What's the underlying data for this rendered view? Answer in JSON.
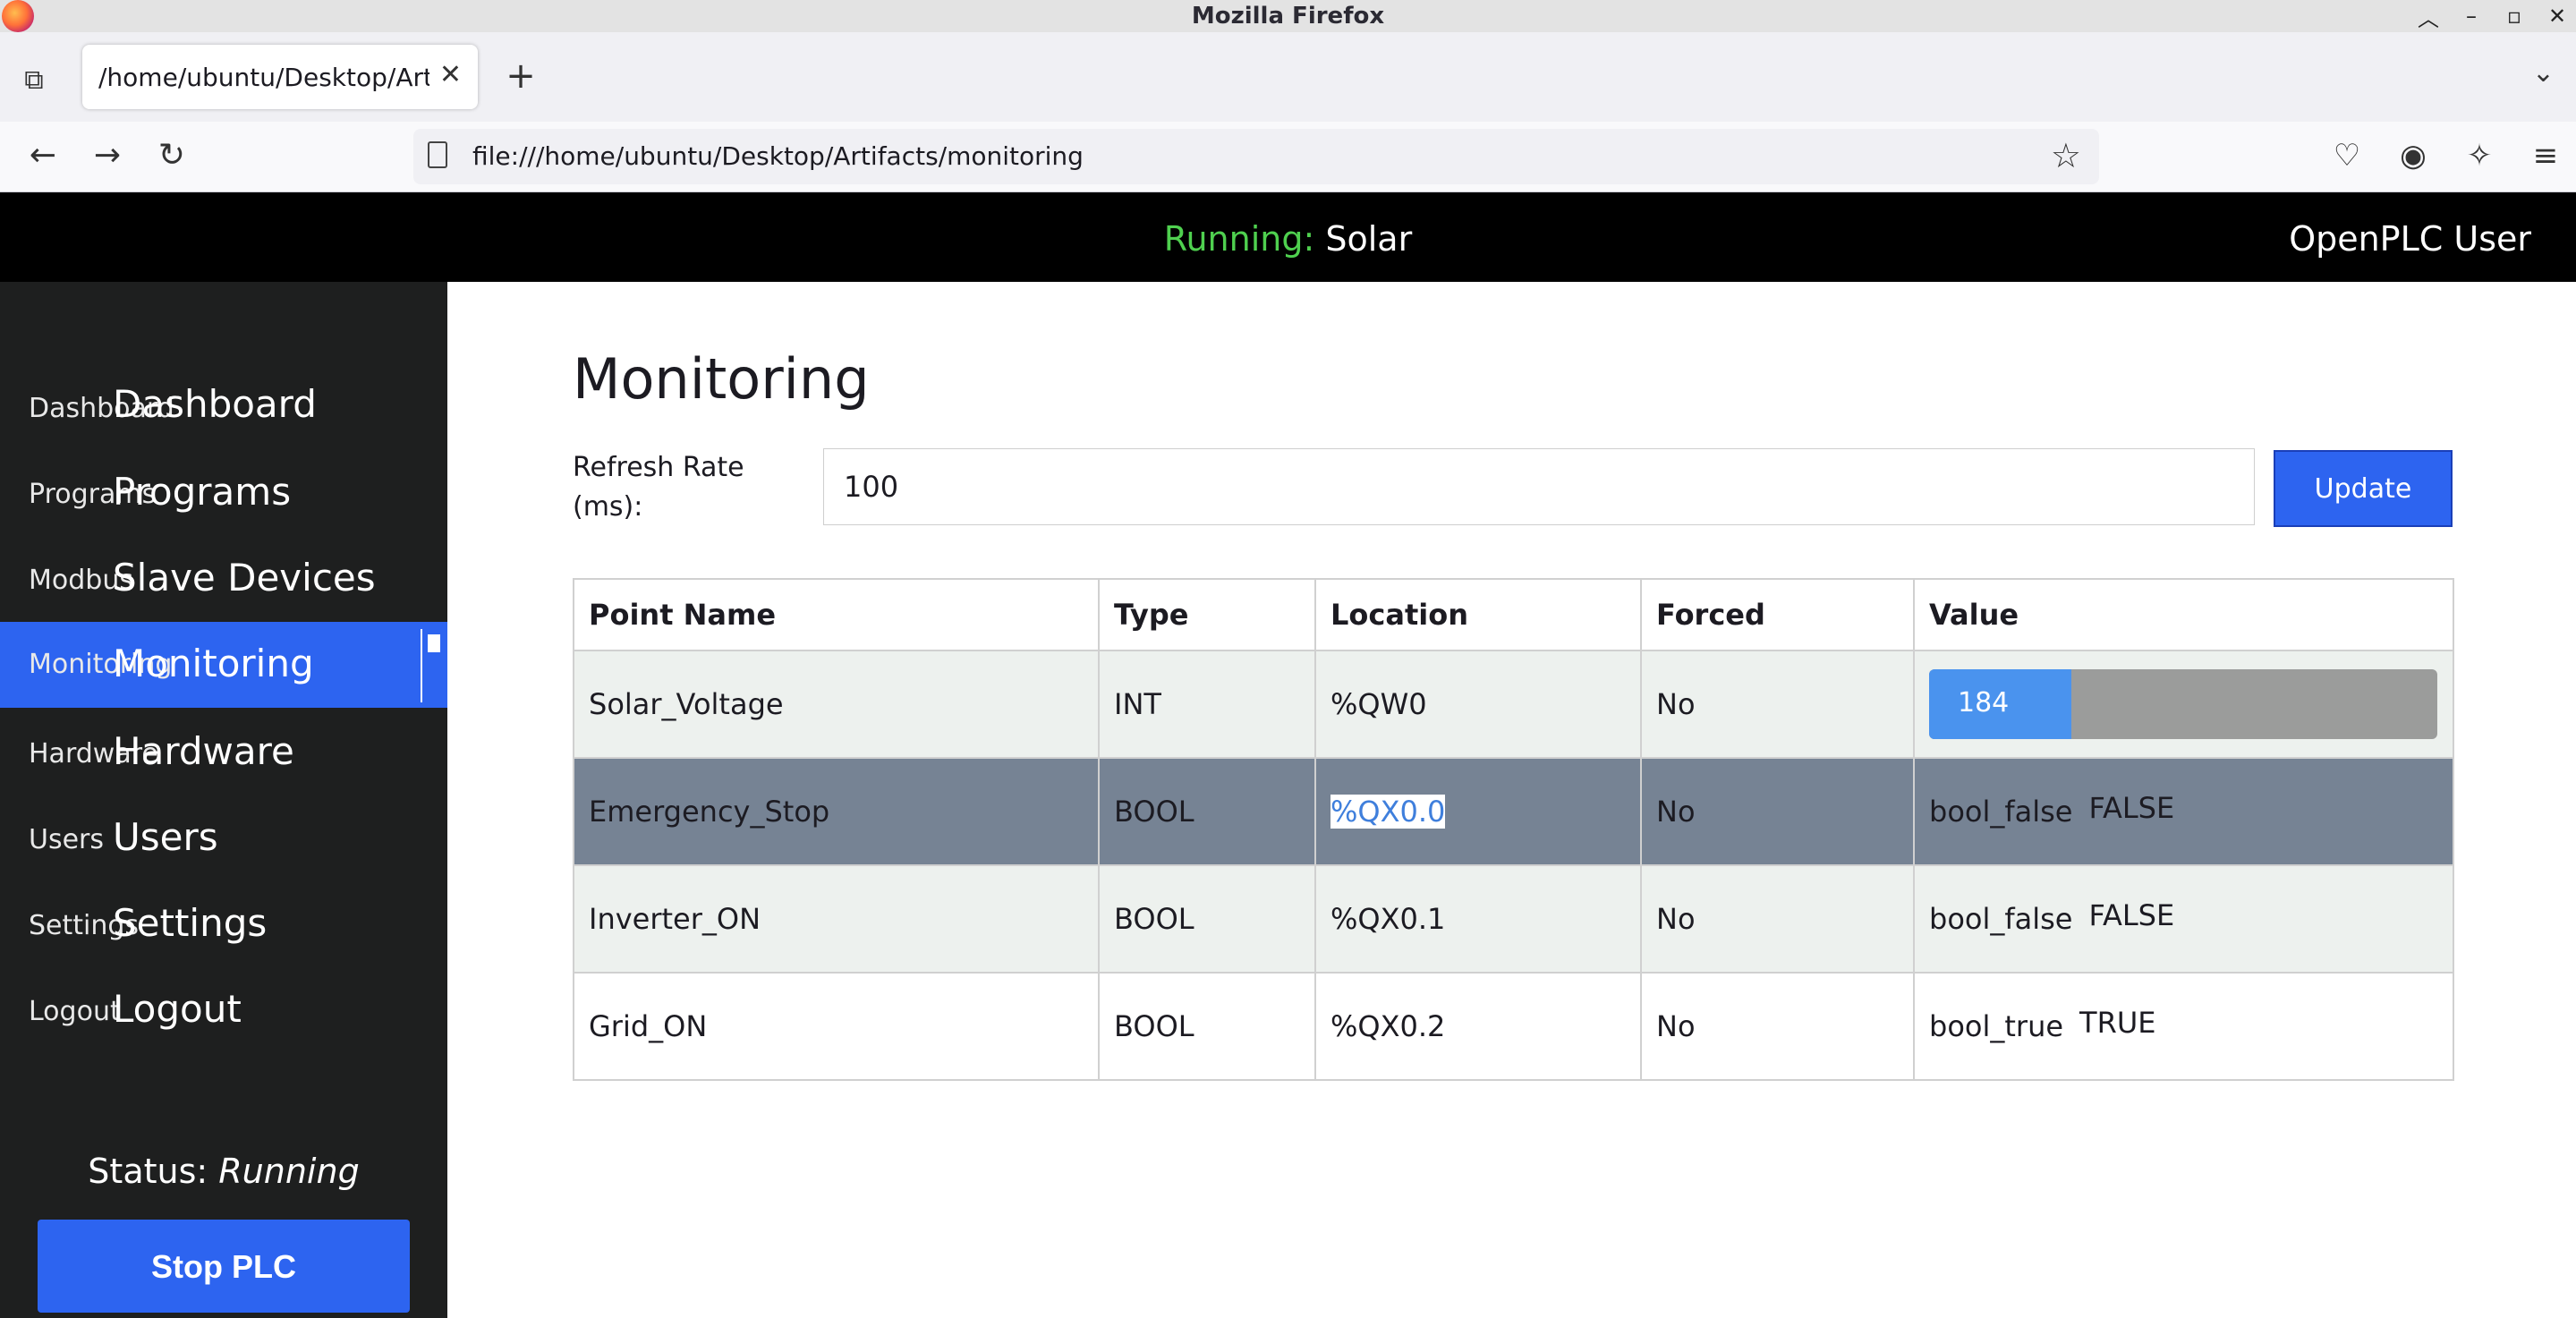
{
  "window": {
    "title": "Mozilla Firefox"
  },
  "browser": {
    "tab_title": "/home/ubuntu/Desktop/Artifacts/monitoring",
    "url": "file:///home/ubuntu/Desktop/Artifacts/monitoring"
  },
  "header": {
    "running_label": "Running:",
    "program_name": "Solar",
    "user": "OpenPLC User"
  },
  "sidebar": {
    "items": [
      {
        "label": "Dashboard",
        "ghost": "Dashboard"
      },
      {
        "label": "Programs",
        "ghost": "Programs"
      },
      {
        "label": "Slave Devices",
        "ghost": "Modbus"
      },
      {
        "label": "Monitoring",
        "ghost": "Monitoring"
      },
      {
        "label": "Hardware",
        "ghost": "Hardware"
      },
      {
        "label": "Users",
        "ghost": "Users"
      },
      {
        "label": "Settings",
        "ghost": "Settings"
      },
      {
        "label": "Logout",
        "ghost": "Logout"
      }
    ],
    "active_index": 3,
    "status_label": "Status:",
    "status_value": "Running",
    "stop_button": "Stop PLC"
  },
  "main": {
    "title": "Monitoring",
    "refresh_label": "Refresh Rate (ms):",
    "refresh_value": "100",
    "update_button": "Update",
    "columns": [
      "Point Name",
      "Type",
      "Location",
      "Forced",
      "Value"
    ],
    "rows": [
      {
        "name": "Solar_Voltage",
        "type": "INT",
        "location": "%QW0",
        "forced": "No",
        "value": "184",
        "bar_fraction": 0.28
      },
      {
        "name": "Emergency_Stop",
        "type": "BOOL",
        "location": "%QX0.0",
        "forced": "No",
        "value_name": "bool_false",
        "value": "FALSE"
      },
      {
        "name": "Inverter_ON",
        "type": "BOOL",
        "location": "%QX0.1",
        "forced": "No",
        "value_name": "bool_false",
        "value": "FALSE"
      },
      {
        "name": "Grid_ON",
        "type": "BOOL",
        "location": "%QX0.2",
        "forced": "No",
        "value_name": "bool_true",
        "value": "TRUE"
      }
    ]
  },
  "colors": {
    "accent": "#2d64f0",
    "running_green": "#4fd04f",
    "selected_row": "#768394",
    "bar_fill": "#4a93ee"
  }
}
